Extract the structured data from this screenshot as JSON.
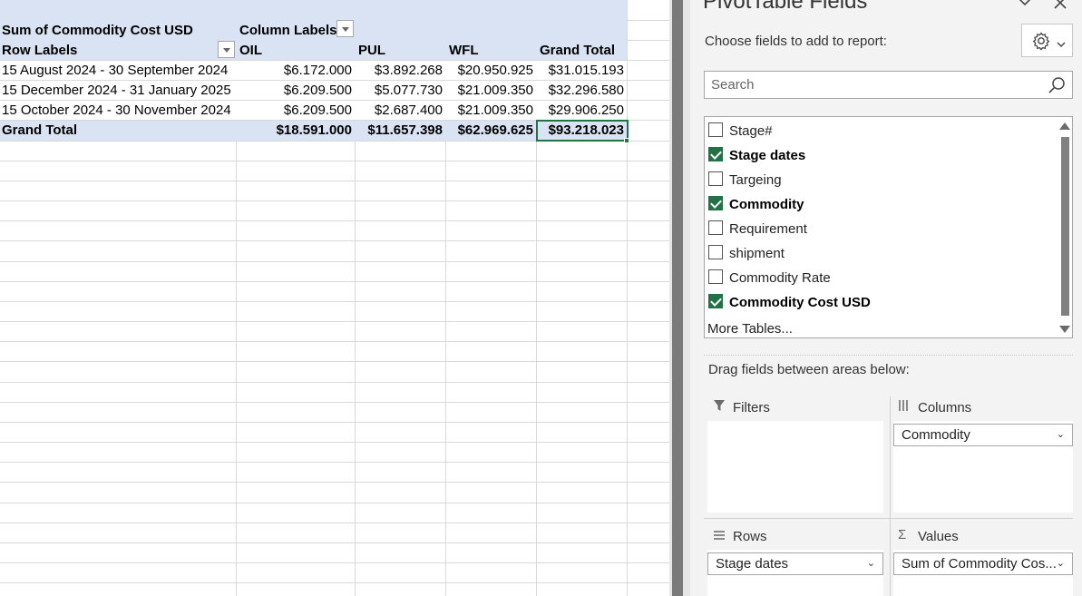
{
  "pivot": {
    "value_header": "Sum of Commodity Cost USD",
    "column_labels": "Column Labels",
    "row_labels": "Row Labels",
    "columns": [
      "OIL",
      "PUL",
      "WFL",
      "Grand Total"
    ],
    "rows": [
      {
        "label": "15 August 2024 - 30 September 2024",
        "values": [
          "$6.172.000",
          "$3.892.268",
          "$20.950.925",
          "$31.015.193"
        ]
      },
      {
        "label": "15 December 2024 - 31 January 2025",
        "values": [
          "$6.209.500",
          "$5.077.730",
          "$21.009.350",
          "$32.296.580"
        ]
      },
      {
        "label": "15 October 2024 - 30 November 2024",
        "values": [
          "$6.209.500",
          "$2.687.400",
          "$21.009.350",
          "$29.906.250"
        ]
      }
    ],
    "grand_total": {
      "label": "Grand Total",
      "values": [
        "$18.591.000",
        "$11.657.398",
        "$62.969.625",
        "$93.218.023"
      ]
    }
  },
  "panel": {
    "title": "PivotTable Fields",
    "choose_label": "Choose fields to add to report:",
    "search_placeholder": "Search",
    "fields": [
      {
        "label": "Stage#",
        "checked": false
      },
      {
        "label": "Stage dates",
        "checked": true
      },
      {
        "label": "Targeing",
        "checked": false
      },
      {
        "label": "Commodity",
        "checked": true
      },
      {
        "label": "Requirement",
        "checked": false
      },
      {
        "label": "shipment",
        "checked": false
      },
      {
        "label": "Commodity Rate",
        "checked": false
      },
      {
        "label": "Commodity Cost USD",
        "checked": true
      }
    ],
    "more_tables": "More Tables...",
    "drag_label": "Drag fields between areas below:",
    "areas": {
      "filters": {
        "title": "Filters"
      },
      "columns": {
        "title": "Columns",
        "item": "Commodity"
      },
      "rows": {
        "title": "Rows",
        "item": "Stage dates"
      },
      "values": {
        "title": "Values",
        "item": "Sum of Commodity Cos..."
      }
    }
  },
  "icons": {
    "settings": "gear-icon",
    "search": "search-icon",
    "close": "close-icon",
    "collapse": "chevron-down-icon"
  },
  "colors": {
    "pivot_header": "#dae3f3",
    "accent": "#217346"
  }
}
